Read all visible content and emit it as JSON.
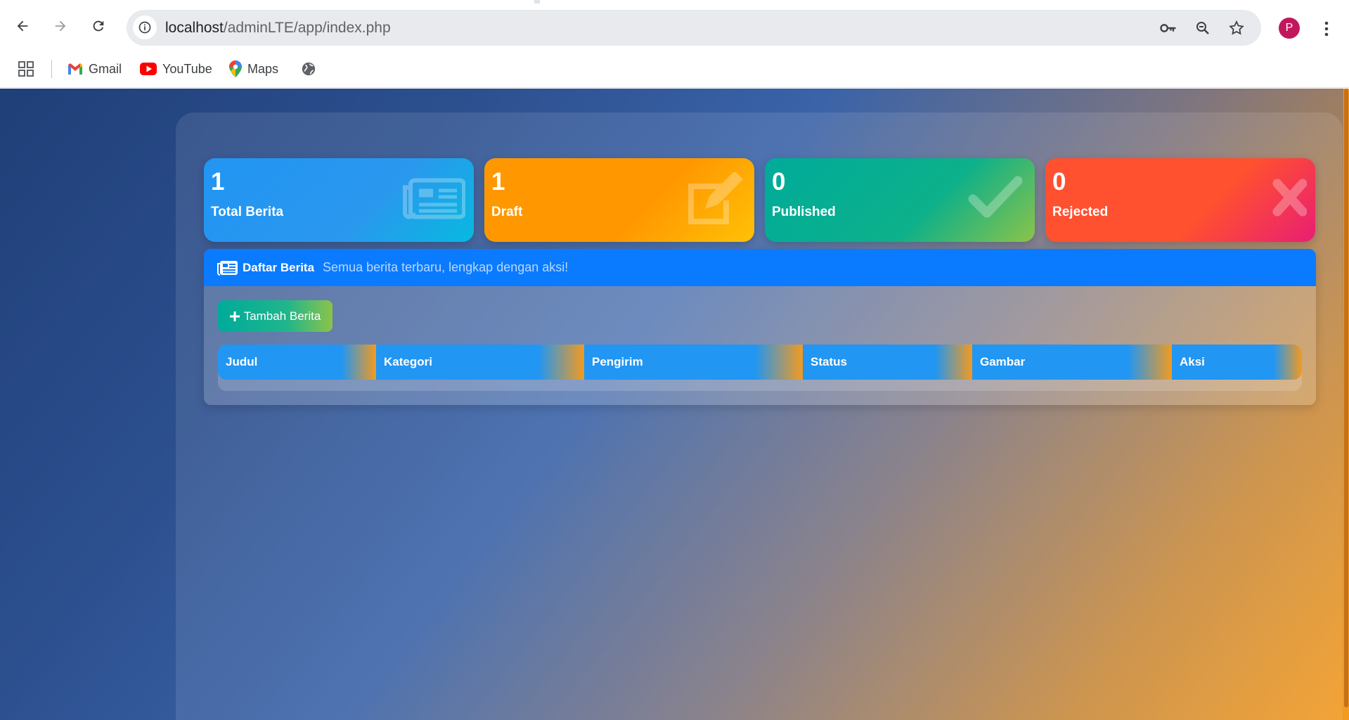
{
  "browser": {
    "url_host": "localhost",
    "url_path": "/adminLTE/app/index.php",
    "profile_initial": "P",
    "bookmarks": [
      {
        "label": "Gmail",
        "icon": "gmail-icon"
      },
      {
        "label": "YouTube",
        "icon": "youtube-icon"
      },
      {
        "label": "Maps",
        "icon": "maps-icon"
      }
    ]
  },
  "stats": [
    {
      "value": "1",
      "label": "Total Berita",
      "icon": "newspaper-icon"
    },
    {
      "value": "1",
      "label": "Draft",
      "icon": "edit-icon"
    },
    {
      "value": "0",
      "label": "Published",
      "icon": "check-icon"
    },
    {
      "value": "0",
      "label": "Rejected",
      "icon": "times-icon"
    }
  ],
  "panel": {
    "title": "Daftar Berita",
    "subtitle": "Semua berita terbaru, lengkap dengan aksi!",
    "add_button": "Tambah Berita",
    "columns": [
      "Judul",
      "Kategori",
      "Pengirim",
      "Status",
      "Gambar",
      "Aksi"
    ],
    "rows": []
  },
  "colors": {
    "blue": "#2196f3",
    "orange": "#ff9800",
    "green": "#00ab9a",
    "red": "#ff5030",
    "header_blue": "#0a7bff"
  }
}
